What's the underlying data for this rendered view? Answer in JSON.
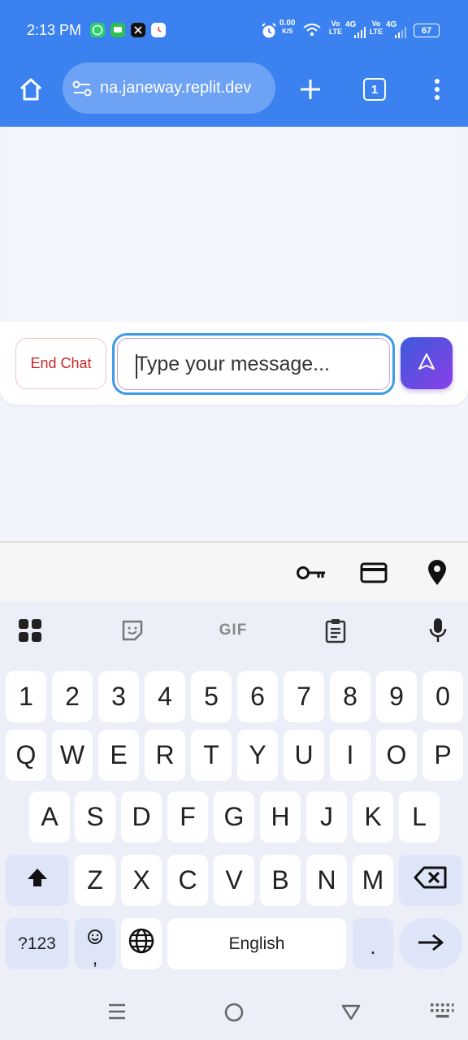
{
  "status_bar": {
    "time": "2:13 PM",
    "net_speed_value": "0.00",
    "net_speed_unit": "K/S",
    "sim1_label": "Vo LTE",
    "sim1_gen": "4G",
    "sim2_label": "Vo LTE",
    "sim2_gen": "4G",
    "battery": "67",
    "colors": {
      "background": "#3b82f0"
    }
  },
  "toolbar": {
    "url": "na.janeway.replit.dev",
    "tab_count": "1",
    "icons": [
      "home-icon",
      "site-settings-icon",
      "new-tab-icon",
      "tab-switcher-icon",
      "more-vertical-icon"
    ]
  },
  "chat": {
    "end_chat_label": "End Chat",
    "input_placeholder": "Type your message...",
    "send_icon": "send-icon",
    "colors": {
      "end_chat_text": "#c62828",
      "send_gradient_start": "#3b5bdb",
      "send_gradient_end": "#8b3ee8"
    }
  },
  "autofill_bar": {
    "icons": [
      "key-icon",
      "credit-card-icon",
      "location-pin-icon"
    ]
  },
  "keyboard_tools": {
    "gif_label": "GIF",
    "icons": [
      "apps-grid-icon",
      "sticker-icon",
      "gif-icon",
      "clipboard-icon",
      "microphone-icon"
    ]
  },
  "keyboard": {
    "row_numbers": [
      "1",
      "2",
      "3",
      "4",
      "5",
      "6",
      "7",
      "8",
      "9",
      "0"
    ],
    "row_top": [
      "Q",
      "W",
      "E",
      "R",
      "T",
      "Y",
      "U",
      "I",
      "O",
      "P"
    ],
    "row_home": [
      "A",
      "S",
      "D",
      "F",
      "G",
      "H",
      "J",
      "K",
      "L"
    ],
    "row_bottom": [
      "Z",
      "X",
      "C",
      "V",
      "B",
      "N",
      "M"
    ],
    "symbols_label": "?123",
    "emoji_comma_label": ",",
    "space_label": "English",
    "period_label": "."
  },
  "nav_bar": {
    "icons": [
      "recents-menu-icon",
      "home-circle-icon",
      "back-triangle-icon",
      "keyboard-switch-icon"
    ]
  }
}
